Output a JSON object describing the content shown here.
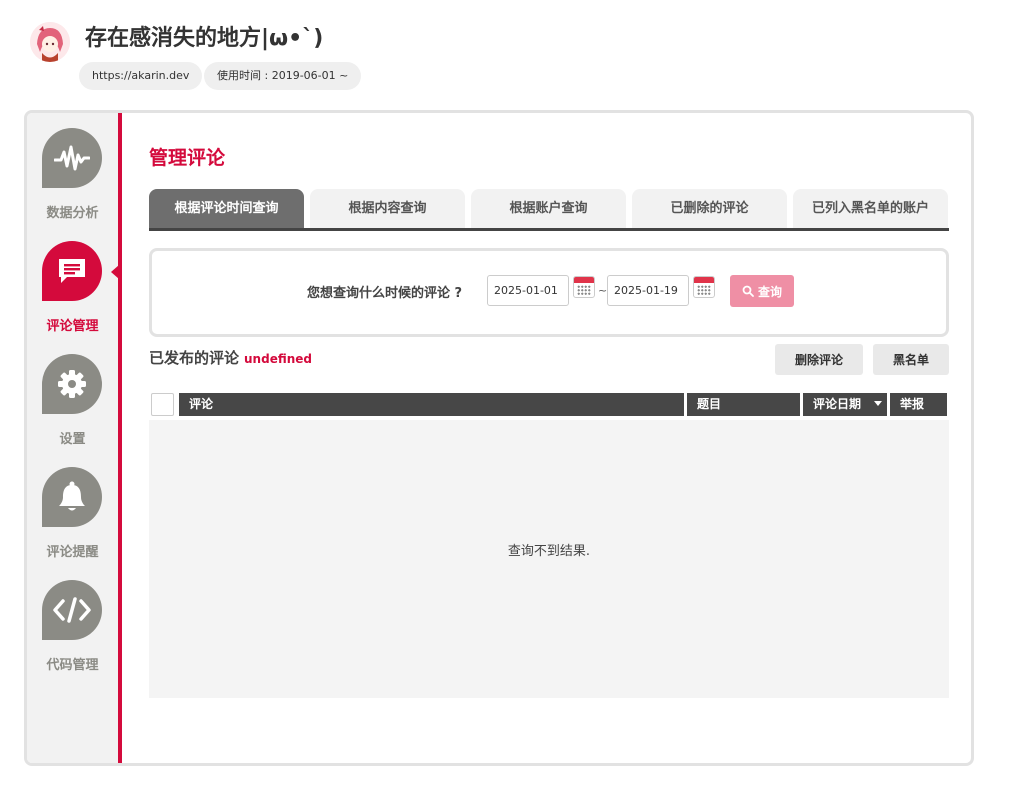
{
  "site": {
    "title": "存在感消失的地方|ω•`)",
    "url": "https://akarin.dev",
    "since": "使用时间 : 2019-06-01 ~"
  },
  "sidebar": {
    "items": [
      {
        "label": "数据分析",
        "icon": "waveform-icon"
      },
      {
        "label": "评论管理",
        "icon": "comment-icon"
      },
      {
        "label": "设置",
        "icon": "gear-icon"
      },
      {
        "label": "评论提醒",
        "icon": "bell-icon"
      },
      {
        "label": "代码管理",
        "icon": "code-icon"
      }
    ],
    "active_index": 1
  },
  "page": {
    "title": "管理评论",
    "tabs": [
      {
        "label": "根据评论时间查询"
      },
      {
        "label": "根据内容查询"
      },
      {
        "label": "根据账户查询"
      },
      {
        "label": "已删除的评论"
      },
      {
        "label": "已列入黑名单的账户"
      }
    ]
  },
  "query": {
    "label": "您想查询什么时候的评论 ?",
    "from_date": "2025-01-01",
    "to_date": "2025-01-19",
    "separator": "~",
    "button": "查询"
  },
  "published": {
    "title": "已发布的评论",
    "count": "undefined",
    "delete_button": "删除评论",
    "blacklist_button": "黑名单"
  },
  "table": {
    "columns": {
      "comment": "评论",
      "subject": "题目",
      "date": "评论日期",
      "report": "举报"
    },
    "empty": "查询不到结果."
  },
  "colors": {
    "accent": "#d40a3c",
    "sidebar_icon": "#8b8b85",
    "query_button": "#ef8fa5",
    "table_header": "#474747"
  }
}
